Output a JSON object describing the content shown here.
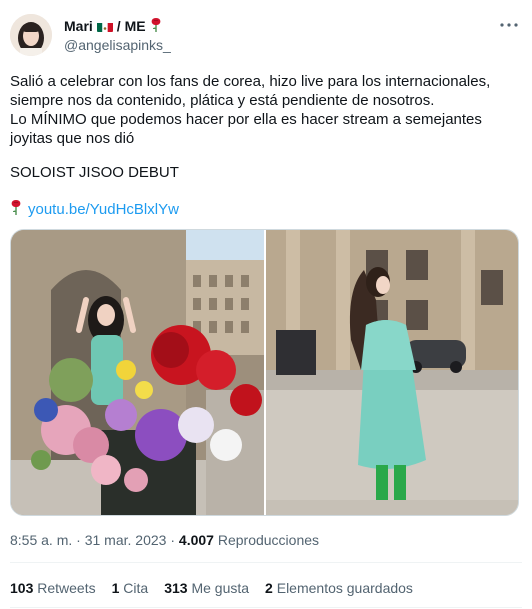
{
  "author": {
    "display_name": "Mari",
    "name_suffix": "/ ME",
    "handle": "@angelisapinks_"
  },
  "icons": {
    "flag": "mexico-flag-icon",
    "rose": "rose-icon",
    "more": "more-icon"
  },
  "tweet": {
    "lines": [
      "Salió a celebrar con los fans de corea, hizo live para los internacionales,",
      "siempre nos da contenido, plática y está pendiente de nosotros.",
      "Lo MÍNIMO que podemos hacer por ella es hacer stream a semejantes",
      "joyitas que nos dió"
    ],
    "soloist": "SOLOIST JISOO DEBUT",
    "link": "youtu.be/YudHcBlxlYw"
  },
  "meta": {
    "time": "8:55 a. m.",
    "separator": "·",
    "date": "31 mar. 2023",
    "views_count": "4.007",
    "views_label": "Reproducciones"
  },
  "stats": {
    "retweets_count": "103",
    "retweets_label": "Retweets",
    "quotes_count": "1",
    "quotes_label": "Cita",
    "likes_count": "313",
    "likes_label": "Me gusta",
    "bookmarks_count": "2",
    "bookmarks_label": "Elementos guardados"
  },
  "colors": {
    "link": "#1d9bf0",
    "secondary_text": "#536471",
    "primary_text": "#0f1419"
  }
}
